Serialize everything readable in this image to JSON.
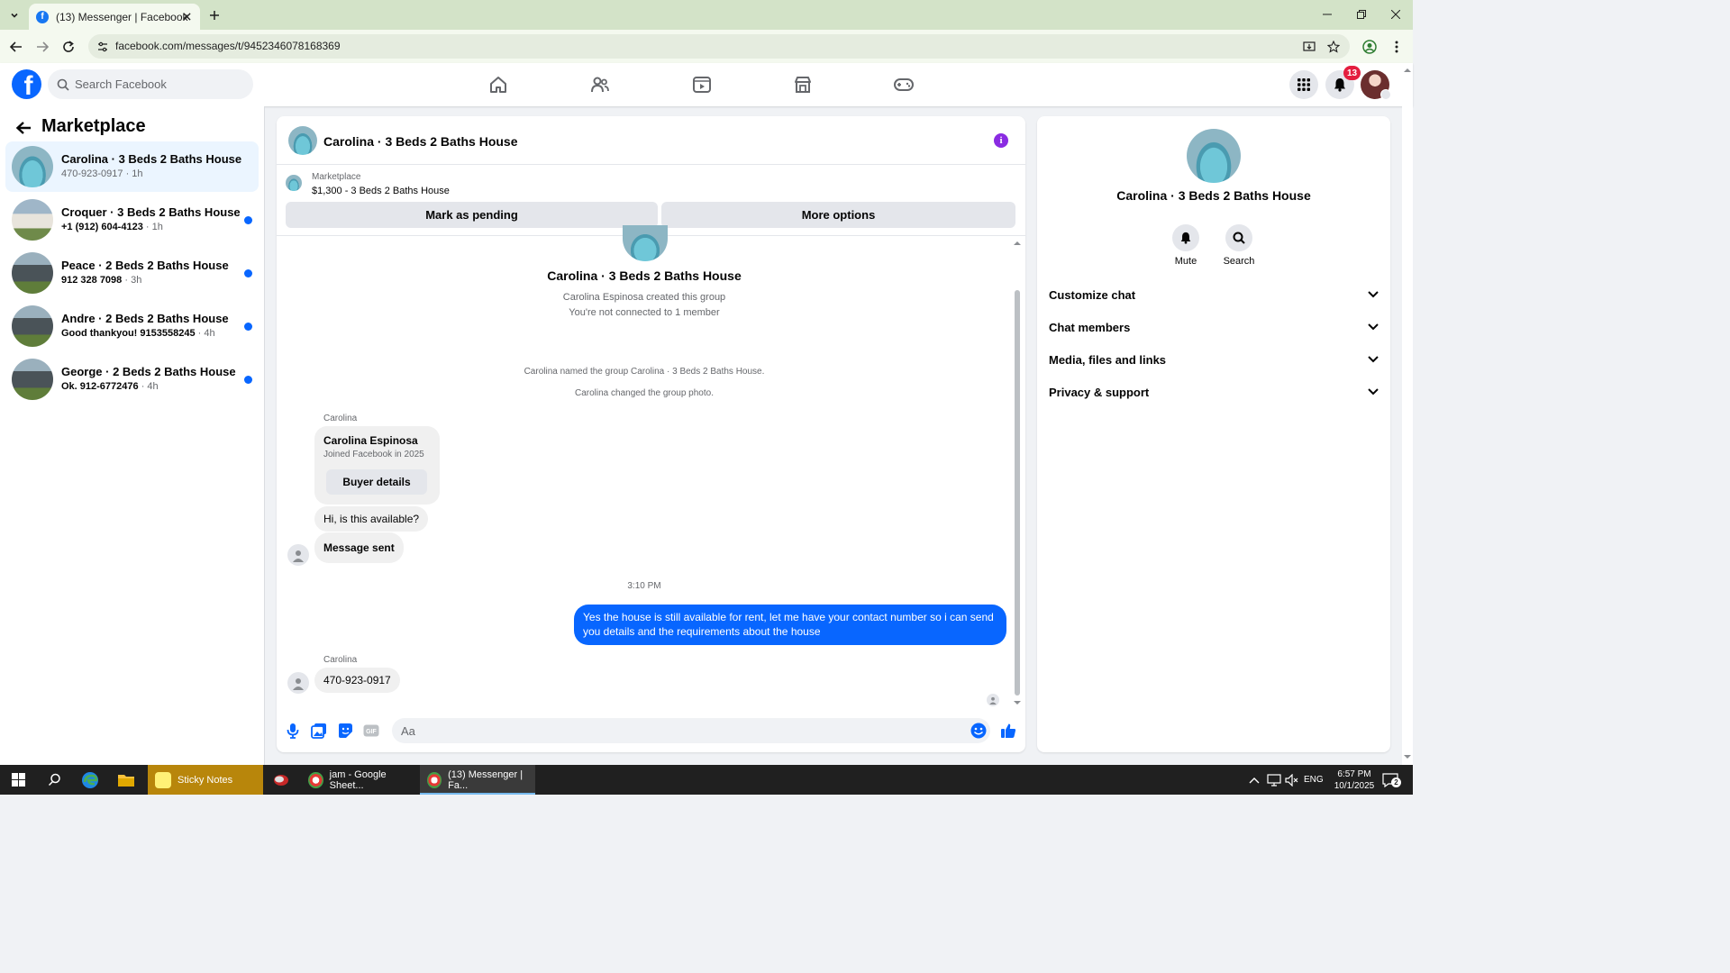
{
  "browser": {
    "tab_title": "(13) Messenger | Facebook",
    "url": "facebook.com/messages/t/9452346078168369"
  },
  "header": {
    "search_placeholder": "Search Facebook",
    "notification_count": "13"
  },
  "sidebar": {
    "title": "Marketplace",
    "conversations": [
      {
        "name": "Carolina · 3 Beds 2 Baths House",
        "preview": "470-923-0917",
        "time": "· 1h",
        "unread": false,
        "active": true
      },
      {
        "name": "Croquer · 3 Beds 2 Baths House",
        "preview": "+1 (912) 604-4123",
        "time": "· 1h",
        "unread": true,
        "active": false
      },
      {
        "name": "Peace · 2 Beds 2 Baths House",
        "preview": "912 328 7098",
        "time": "· 3h",
        "unread": true,
        "active": false
      },
      {
        "name": "Andre · 2 Beds 2 Baths House",
        "preview": "Good thankyou! 9153558245",
        "time": "· 4h",
        "unread": true,
        "active": false
      },
      {
        "name": "George · 2 Beds 2 Baths House",
        "preview": "Ok. 912-6772476",
        "time": "· 4h",
        "unread": true,
        "active": false
      }
    ]
  },
  "chat": {
    "title": "Carolina · 3 Beds 2 Baths House",
    "marketplace_label": "Marketplace",
    "listing": "$1,300 - 3 Beds 2 Baths House",
    "mark_pending": "Mark as pending",
    "more_options": "More options",
    "group_title": "Carolina · 3 Beds 2 Baths House",
    "created": "Carolina Espinosa created this group",
    "not_connected": "You're not connected to 1 member",
    "named": "Carolina named the group Carolina · 3 Beds 2 Baths House.",
    "changed_photo": "Carolina changed the group photo.",
    "sender_1": "Carolina",
    "card_name": "Carolina Espinosa",
    "card_sub": "Joined Facebook in 2025",
    "card_button": "Buyer details",
    "msg_available": "Hi, is this available?",
    "msg_sent": "Message sent",
    "timestamp": "3:10 PM",
    "msg_out": "Yes the house is still available for rent, let me have your contact number so i can send you details and the requirements about the house",
    "sender_2": "Carolina",
    "msg_phone": "470-923-0917",
    "composer_placeholder": "Aa"
  },
  "right_panel": {
    "title": "Carolina · 3 Beds 2 Baths House",
    "mute": "Mute",
    "search": "Search",
    "sections": [
      "Customize chat",
      "Chat members",
      "Media, files and links",
      "Privacy & support"
    ]
  },
  "taskbar": {
    "apps": [
      "Sticky Notes",
      "jam - Google Sheet...",
      "(13) Messenger | Fa..."
    ],
    "lang": "ENG",
    "time": "6:57 PM",
    "date": "10/1/2025",
    "notif_count": "2"
  },
  "colors": {
    "fb_blue": "#0866ff",
    "unread_dot": "#0866ff",
    "info": "#8a2be2",
    "badge": "#e41e3f"
  }
}
